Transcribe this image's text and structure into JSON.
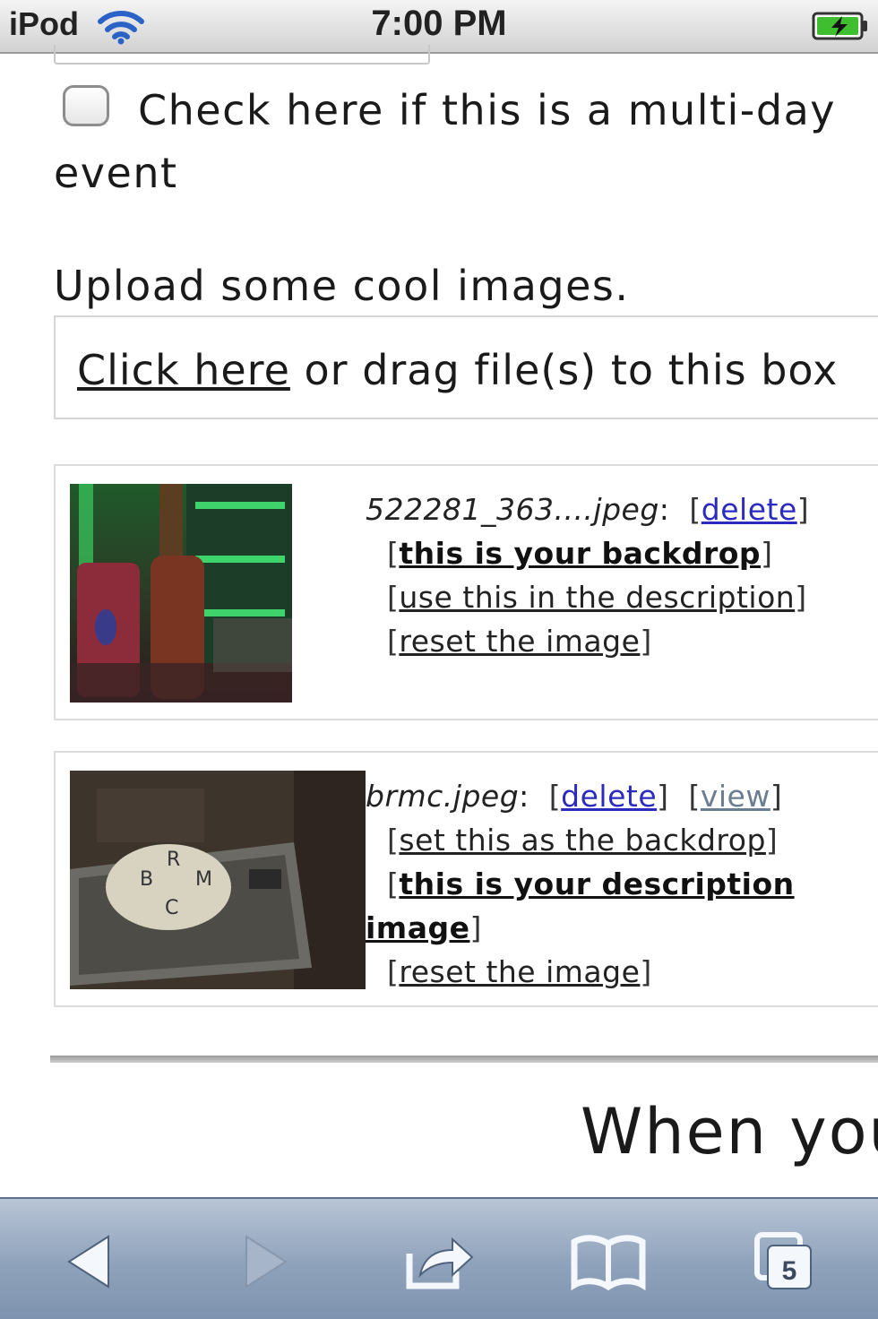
{
  "status_bar": {
    "carrier": "iPod",
    "time": "7:00 PM"
  },
  "form": {
    "multiday_label": "Check here if this is a multi-day event",
    "multiday_checked": false,
    "upload_title": "Upload some cool images.",
    "dropzone_link": "Click here",
    "dropzone_text": " or drag file(s) to this box"
  },
  "images": [
    {
      "filename": "522281_363....jpeg",
      "delete_label": "delete",
      "backdrop_label": "this is your backdrop",
      "description_label": "use this in the description",
      "reset_label": "reset the image"
    },
    {
      "filename": "brmc.jpeg",
      "delete_label": "delete",
      "view_label": "view",
      "backdrop_label": "set this as the backdrop",
      "description_label_1": "this is your description",
      "description_label_2": "image",
      "reset_label": "reset the image"
    }
  ],
  "footer_heading": "When you",
  "toolbar": {
    "tabs_count": "5",
    "icons": [
      "back-icon",
      "forward-icon",
      "share-icon",
      "bookmarks-icon",
      "tabs-icon"
    ]
  },
  "colors": {
    "link_blue": "#2b2bbf",
    "link_gray": "#6b7d92",
    "toolbar_blue": "#8fa2bb"
  }
}
